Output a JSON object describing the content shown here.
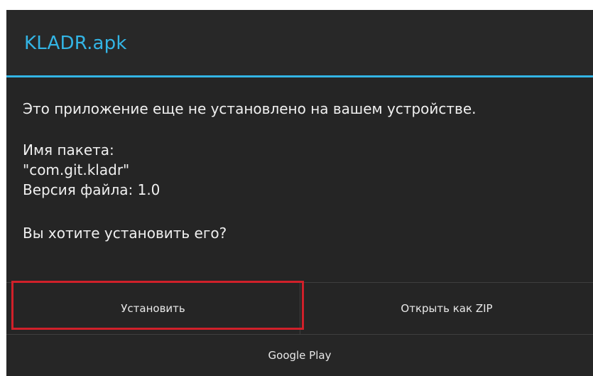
{
  "dialog": {
    "title": "KLADR.apk",
    "message": "Это приложение еще не установлено на вашем устройстве.",
    "package_label": "Имя пакета:",
    "package_name": "\"com.git.kladr\"",
    "file_version": "Версия файла: 1.0",
    "question": "Вы хотите установить его?"
  },
  "buttons": {
    "install": "Установить",
    "open_as_zip": "Открыть как ZIP",
    "google_play": "Google Play"
  },
  "colors": {
    "accent": "#33b5e5",
    "dialog_background": "#282828",
    "highlight": "#d0202a"
  }
}
